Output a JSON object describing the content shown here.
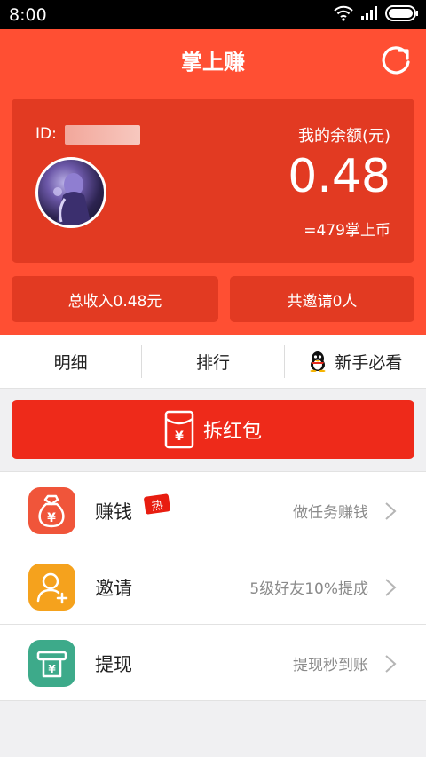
{
  "status_bar": {
    "time": "8:00"
  },
  "header": {
    "title": "掌上赚"
  },
  "account": {
    "id_label": "ID:",
    "balance_label": "我的余额(元)",
    "balance": "0.48",
    "coins": "=479掌上币"
  },
  "stats": {
    "total_income": "总收入0.48元",
    "invited": "共邀请0人"
  },
  "tabs": [
    {
      "label": "明细"
    },
    {
      "label": "排行"
    },
    {
      "label": "新手必看",
      "icon": "qq-penguin-icon"
    }
  ],
  "red_packet": {
    "label": "拆红包"
  },
  "menu": [
    {
      "title": "赚钱",
      "badge": "热",
      "desc": "做任务赚钱",
      "icon": "money-bag-icon",
      "color": "#f0553a"
    },
    {
      "title": "邀请",
      "desc": "5级好友10%提成",
      "icon": "invite-user-icon",
      "color": "#f5a21d"
    },
    {
      "title": "提现",
      "desc": "提现秒到账",
      "icon": "withdraw-icon",
      "color": "#3daa8a"
    }
  ],
  "colors": {
    "primary": "#ff4f33",
    "card": "#e23a22",
    "button": "#ee2a1a"
  }
}
